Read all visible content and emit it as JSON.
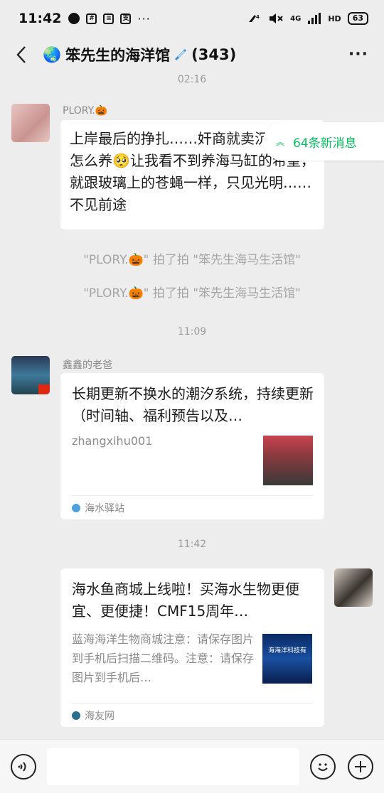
{
  "status_bar": {
    "time": "11:42",
    "more": "···",
    "network": "4G",
    "hd": "HD",
    "battery": "63"
  },
  "header": {
    "back_icon": "back-arrow",
    "title": "笨先生的海洋馆",
    "member_count": "(343)",
    "more_icon": "more-dots"
  },
  "new_messages": {
    "label": "64条新消息"
  },
  "chat": {
    "time_1": "02:16",
    "msg1": {
      "sender": "PLORY.🎃",
      "text": "上岸最后的挣扎……奸商就卖沉不教我怎么养🥺让我看不到养海马缸的希望，就跟玻璃上的苍蝇一样，只见光明……不见前途"
    },
    "system_1": "\"PLORY.🎃\" 拍了拍 \"笨先生海马生活馆\"",
    "system_2": "\"PLORY.🎃\" 拍了拍 \"笨先生海马生活馆\"",
    "time_2": "11:09",
    "msg2": {
      "sender": "鑫鑫的老爸",
      "card_title": "长期更新不换水的潮汐系统，持续更新（时间轴、福利预告以及…",
      "card_desc": "zhangxihu001",
      "source": "海水驿站"
    },
    "time_3": "11:42",
    "msg3": {
      "card_title": "海水鱼商城上线啦！买海水生物更便宜、更便捷！CMF15周年…",
      "card_desc": "蓝海海洋生物商城注意：请保存图片到手机后扫描二维码。注意：请保存图片到手机后…",
      "thumb_text": "海海洋科技有",
      "source": "海友网"
    }
  },
  "input_bar": {
    "voice_icon": "voice-icon",
    "emoji_icon": "emoji-icon",
    "plus_icon": "plus-icon"
  },
  "colors": {
    "accent": "#07c160",
    "background": "#ededed"
  }
}
